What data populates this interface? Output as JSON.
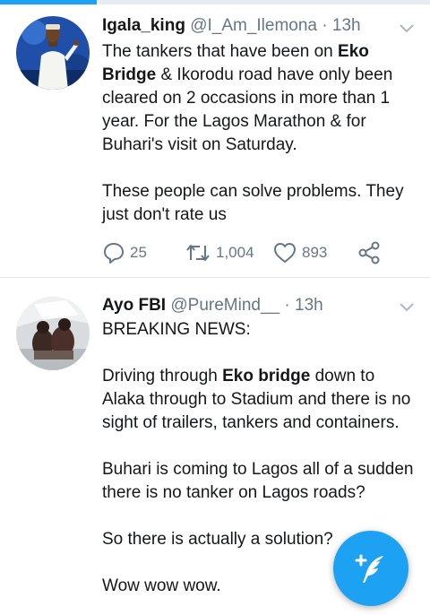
{
  "tweets": [
    {
      "name": "Igala_king",
      "handle": "@I_Am_Ilemona",
      "separator": "·",
      "time": "13h",
      "avatar_icon": "avatar-person-white-agbada",
      "body": {
        "p1_a": "The tankers that have been on ",
        "p1_b": "Eko Bridge",
        "p1_c": " & Ikorodu road have only been cleared on 2 occasions in more than 1 year. For the Lagos Marathon & for Buhari's visit on Saturday.",
        "p2": "These people can solve problems. They just don't rate us"
      },
      "actions": {
        "replies": "25",
        "retweets": "1,004",
        "likes": "893"
      }
    },
    {
      "name": "Ayo FBI",
      "handle": "@PureMind__",
      "separator": "·",
      "time": "13h",
      "avatar_icon": "avatar-photo-people",
      "body": {
        "p1": "BREAKING NEWS:",
        "p2_a": "Driving through ",
        "p2_b": "Eko bridge",
        "p2_c": " down to Alaka through to Stadium and there is no sight of trailers, tankers and containers.",
        "p3": "Buhari is coming to Lagos all of a sudden there is no tanker on Lagos roads?",
        "p4": "So there is actually a solution?",
        "p5": "Wow wow wow."
      }
    }
  ],
  "fab": {
    "icon": "compose-tweet-icon"
  },
  "colors": {
    "accent": "#1da1f2",
    "text": "#14171a",
    "secondary": "#657786",
    "divider": "#e1e8ed"
  }
}
